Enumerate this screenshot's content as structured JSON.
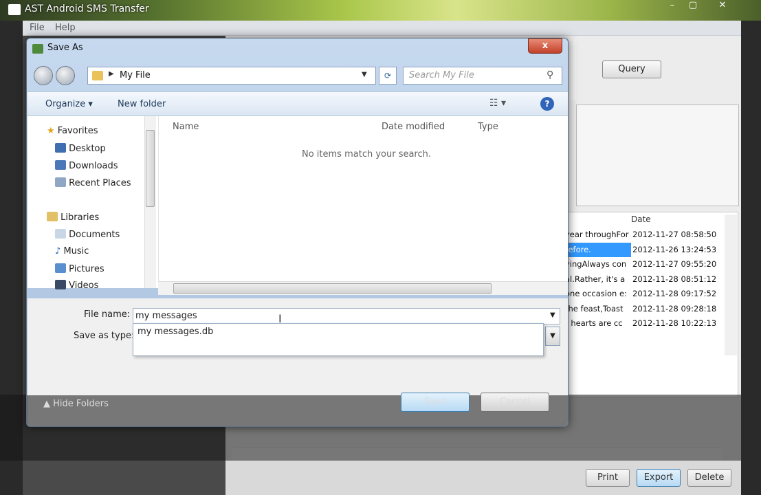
{
  "app": {
    "title": "AST Android SMS Transfer",
    "menu": [
      "File",
      "Help"
    ],
    "window_controls": [
      "–",
      "▢",
      "✕"
    ],
    "query_label": "Query",
    "messages_header_date": "Date",
    "messages": [
      {
        "text": "year throughFor",
        "date": "2012-11-27 08:58:50",
        "selected": false
      },
      {
        "text": "refore.",
        "date": "2012-11-26 13:24:53",
        "selected": true
      },
      {
        "text": "yingAlways con",
        "date": "2012-11-27 09:55:20",
        "selected": false
      },
      {
        "text": "al.Rather, it's a",
        "date": "2012-11-28 08:51:12",
        "selected": false
      },
      {
        "text": "one occasion e:",
        "date": "2012-11-28 09:17:52",
        "selected": false
      },
      {
        "text": "the feast,Toast",
        "date": "2012-11-28 09:28:18",
        "selected": false
      },
      {
        "text": "r hearts are cc",
        "date": "2012-11-28 10:22:13",
        "selected": false
      }
    ],
    "buttons": {
      "print": "Print",
      "export": "Export",
      "delete": "Delete"
    }
  },
  "dialog": {
    "title": "Save As",
    "close_label": "x",
    "address": "My File",
    "search_placeholder": "Search My File",
    "toolbar": {
      "organize": "Organize ▾",
      "new_folder": "New folder"
    },
    "nav": {
      "favorites": "Favorites",
      "favorites_items": [
        "Desktop",
        "Downloads",
        "Recent Places"
      ],
      "libraries": "Libraries",
      "libraries_items": [
        "Documents",
        "Music",
        "Pictures",
        "Videos"
      ]
    },
    "columns": {
      "name": "Name",
      "date_modified": "Date modified",
      "type": "Type"
    },
    "empty_message": "No items match your search.",
    "file_name_label": "File name:",
    "file_name_value": "my messages",
    "save_as_type_label": "Save as type:",
    "suggestion": "my messages.db",
    "hide_folders": "Hide Folders",
    "save_label": "Save",
    "cancel_label": "Cancel"
  },
  "colors": {
    "selection": "#3399ff",
    "title_green": "#a9c64a",
    "dialog_frame": "#c6d9ef"
  }
}
